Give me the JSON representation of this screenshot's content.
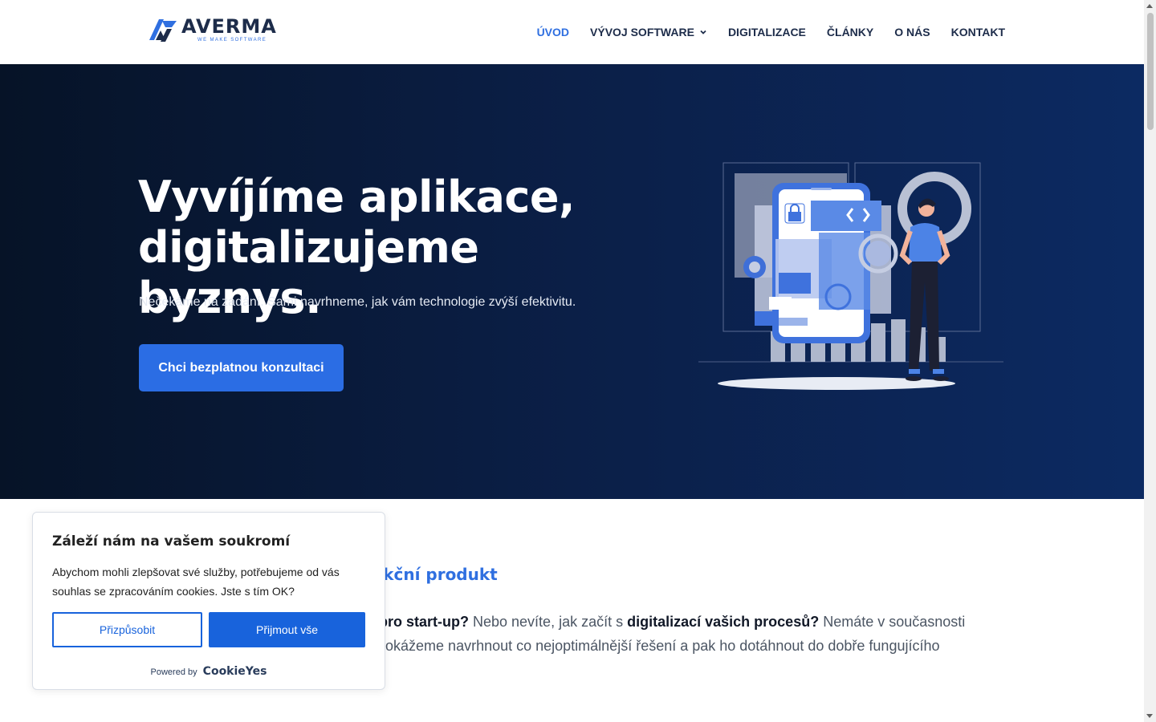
{
  "brand": {
    "name": "AVERMA",
    "tagline": "WE MAKE SOFTWARE",
    "accent_color": "#2f6fe0",
    "navy_color": "#1d2c4a"
  },
  "nav": {
    "items": [
      {
        "label": "ÚVOD",
        "active": true
      },
      {
        "label": "VÝVOJ SOFTWARE",
        "has_dropdown": true
      },
      {
        "label": "DIGITALIZACE"
      },
      {
        "label": "ČLÁNKY"
      },
      {
        "label": "O NÁS"
      },
      {
        "label": "KONTAKT"
      }
    ]
  },
  "hero": {
    "title_line1": "Vyvíjíme aplikace,",
    "title_line2": "digitalizujeme byznys.",
    "subtitle": "Nečekáme na zadání. Sami navrhneme, jak vám technologie zvýší efektivitu.",
    "cta_label": "Chci bezplatnou konzultaci",
    "cta_color": "#2b6de4"
  },
  "content": {
    "heading_visible": "funkční produkt",
    "para_line1_bold1": "ukt pro start-up?",
    "para_line1_text1": " Nebo nevíte, jak začít s ",
    "para_line1_bold2": "digitalizací vašich procesů?",
    "para_line1_text2": " Nemáte v současnosti",
    "para_line2": "ám dokážeme navrhnout co nejoptimálnější řešení a pak ho dotáhnout do dobře fungujícího"
  },
  "cookie": {
    "title": "Záleží nám na vašem soukromí",
    "text": "Abychom mohli zlepšovat své služby, potřebujeme od vás souhlas se zpracováním cookies. Jste s tím OK?",
    "customize_label": "Přizpůsobit",
    "accept_label": "Přijmout vše",
    "powered_by": "Powered by",
    "powered_brand": "CookieYes",
    "button_color": "#1863dc"
  }
}
